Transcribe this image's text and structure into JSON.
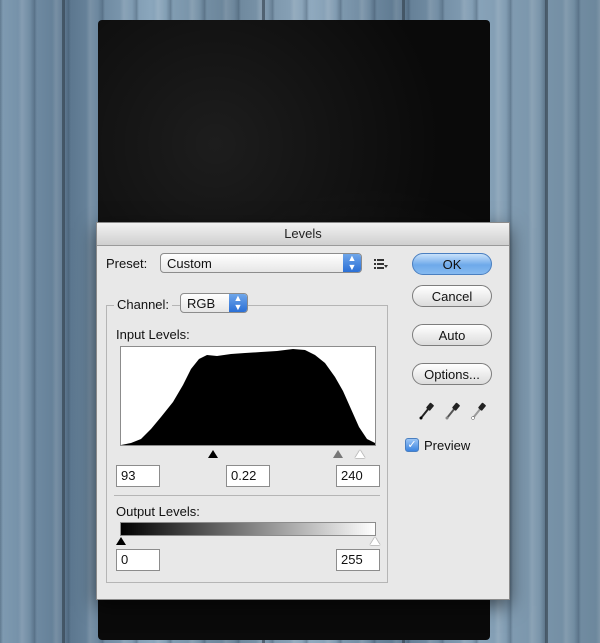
{
  "dialog": {
    "title": "Levels",
    "preset_label": "Preset:",
    "preset_value": "Custom",
    "channel_label": "Channel:",
    "channel_value": "RGB",
    "input_levels_label": "Input Levels:",
    "input_black": "93",
    "input_gamma": "0.22",
    "input_white": "240",
    "output_levels_label": "Output Levels:",
    "output_black": "0",
    "output_white": "255",
    "buttons": {
      "ok": "OK",
      "cancel": "Cancel",
      "auto": "Auto",
      "options": "Options..."
    },
    "preview_label": "Preview",
    "preview_checked": true
  },
  "icons": {
    "preset_menu": "list-menu-icon",
    "eyedroppers": [
      "black-eyedropper-icon",
      "gray-eyedropper-icon",
      "white-eyedropper-icon"
    ]
  },
  "colors": {
    "accent": "#2a6fd6",
    "default_button": "#6ea9ea"
  }
}
